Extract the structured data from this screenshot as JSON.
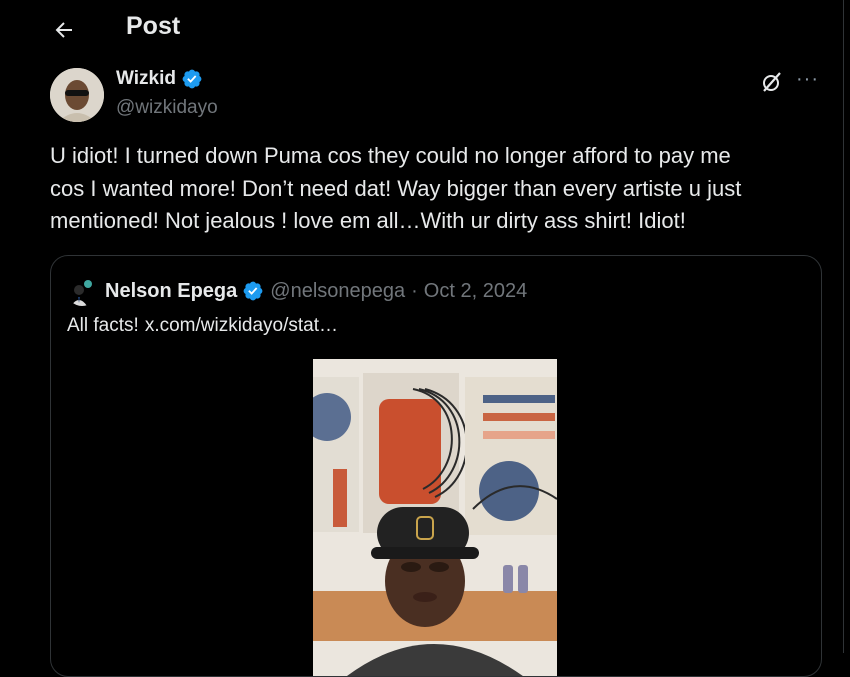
{
  "header": {
    "title": "Post"
  },
  "post": {
    "author_name": "Wizkid",
    "author_handle": "@wizkidayo",
    "text": "U idiot! I turned down Puma cos they could no longer afford to pay me\ncos I wanted more! Don’t need dat! Way bigger than every artiste u just\nmentioned! Not jealous ! love em all…With ur dirty ass shirt! Idiot!"
  },
  "quote": {
    "author_name": "Nelson Epega",
    "author_handle": "@nelsonepega",
    "separator": "·",
    "date": "Oct 2, 2024",
    "text": "All facts!",
    "link": "x.com/wizkidayo/stat…"
  },
  "icons": {
    "back": "arrow-left-icon",
    "verified": "verified-badge-icon",
    "grok": "grok-icon",
    "more": "more-icon"
  },
  "colors": {
    "background": "#000000",
    "text": "#e7e9ea",
    "secondary_text": "#71767b",
    "verified": "#1d9bf0",
    "border": "#2f3336"
  }
}
